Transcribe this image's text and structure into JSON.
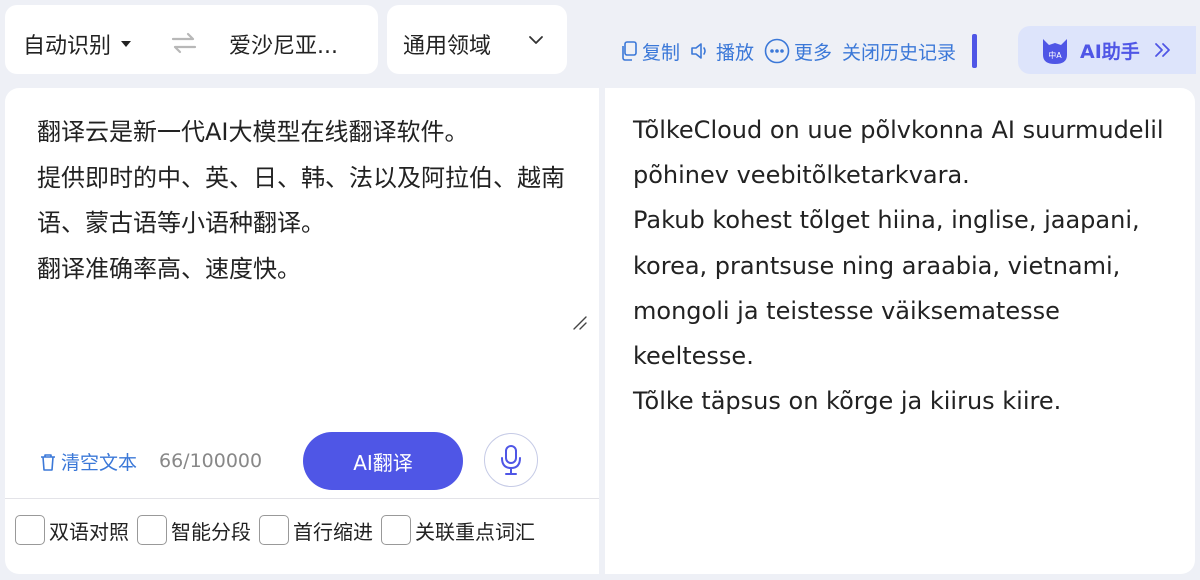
{
  "lang_selector": {
    "source": "自动识别",
    "target": "爱沙尼亚..."
  },
  "domain_selector": {
    "label": "通用领域"
  },
  "toolbar": {
    "copy": "复制",
    "play": "播放",
    "more": "更多",
    "close_history": "关闭历史记录"
  },
  "ai_assistant": {
    "label": "AI助手",
    "avatar_text": "中A"
  },
  "source": {
    "text": "翻译云是新一代AI大模型在线翻译软件。\n提供即时的中、英、日、韩、法以及阿拉伯、越南语、蒙古语等小语种翻译。\n翻译准确率高、速度快。",
    "clear_label": "清空文本",
    "counter": "66/100000",
    "translate_label": "AI翻译",
    "options": [
      "双语对照",
      "智能分段",
      "首行缩进",
      "关联重点词汇"
    ]
  },
  "target": {
    "text": "TõlkeCloud on uue põlvkonna AI suurmudelil põhinev veebitõlketarkvara.\nPakub kohest tõlget hiina, inglise, jaapani, korea, prantsuse ning araabia, vietnami, mongoli ja teistesse väiksematesse keeltesse.\nTõlke täpsus on kõrge ja kiirus kiire."
  },
  "colors": {
    "accent": "#4f56e6",
    "link": "#3b78d8",
    "background": "#eef0f6"
  }
}
